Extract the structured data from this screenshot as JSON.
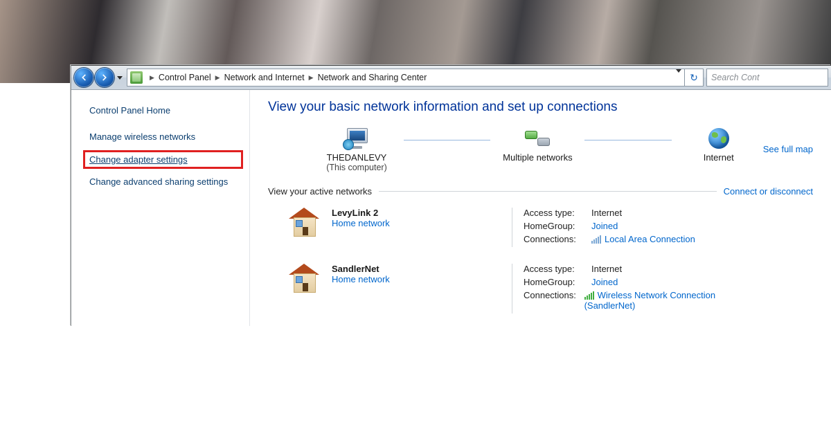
{
  "breadcrumb": {
    "items": [
      "Control Panel",
      "Network and Internet",
      "Network and Sharing Center"
    ]
  },
  "search": {
    "placeholder": "Search Cont"
  },
  "sidebar": {
    "home": "Control Panel Home",
    "links": {
      "manage_wireless": "Manage wireless networks",
      "change_adapter": "Change adapter settings",
      "change_advanced": "Change advanced sharing settings"
    }
  },
  "main": {
    "title": "View your basic network information and set up connections",
    "see_full_map": "See full map",
    "map": {
      "computer": {
        "name": "THEDANLEVY",
        "sub": "(This computer)"
      },
      "middle": "Multiple networks",
      "internet": "Internet"
    },
    "active_section": {
      "label": "View your active networks",
      "action": "Connect or disconnect"
    },
    "labels": {
      "access_type": "Access type:",
      "homegroup": "HomeGroup:",
      "connections": "Connections:"
    },
    "networks": [
      {
        "name": "LevyLink  2",
        "type": "Home network",
        "access": "Internet",
        "homegroup": "Joined",
        "conn_label": "Local Area Connection",
        "wifi": false
      },
      {
        "name": "SandlerNet",
        "type": "Home network",
        "access": "Internet",
        "homegroup": "Joined",
        "conn_label": "Wireless Network Connection (SandlerNet)",
        "wifi": true
      }
    ]
  }
}
